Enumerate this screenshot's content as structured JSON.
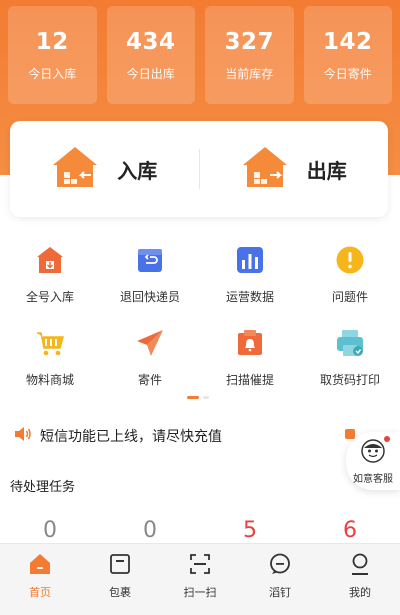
{
  "stats": [
    {
      "value": "12",
      "label": "今日入库"
    },
    {
      "value": "434",
      "label": "今日出库"
    },
    {
      "value": "327",
      "label": "当前库存"
    },
    {
      "value": "142",
      "label": "今日寄件"
    }
  ],
  "io": {
    "in_label": "入库",
    "out_label": "出库"
  },
  "grid": [
    {
      "label": "全号入库",
      "icon": "warehouse-icon",
      "color": "#ee6a3a"
    },
    {
      "label": "退回快递员",
      "icon": "return-box-icon",
      "color": "#4a72e8"
    },
    {
      "label": "运营数据",
      "icon": "bar-chart-icon",
      "color": "#4a72e8"
    },
    {
      "label": "问题件",
      "icon": "exclamation-icon",
      "color": "#f6b51a"
    },
    {
      "label": "物料商城",
      "icon": "shopping-cart-icon",
      "color": "#f6b51a"
    },
    {
      "label": "寄件",
      "icon": "paper-plane-icon",
      "color": "#ee6a3a"
    },
    {
      "label": "扫描催提",
      "icon": "bell-box-icon",
      "color": "#ee6a3a"
    },
    {
      "label": "取货码打印",
      "icon": "printer-icon",
      "color": "#5cc0d0"
    }
  ],
  "notice": {
    "text": "短信功能已上线，请尽快充值"
  },
  "service": {
    "label": "如意客服"
  },
  "tasks": {
    "title": "待处理任务",
    "values": [
      "0",
      "0",
      "5",
      "6"
    ]
  },
  "tabs": [
    {
      "label": "首页",
      "icon": "home-icon",
      "active": true
    },
    {
      "label": "包裹",
      "icon": "package-icon",
      "active": false
    },
    {
      "label": "扫一扫",
      "icon": "scan-icon",
      "active": false
    },
    {
      "label": "滔钉",
      "icon": "chat-icon",
      "active": false
    },
    {
      "label": "我的",
      "icon": "profile-icon",
      "active": false
    }
  ],
  "colors": {
    "accent": "#f37b32",
    "alert": "#e64340"
  }
}
